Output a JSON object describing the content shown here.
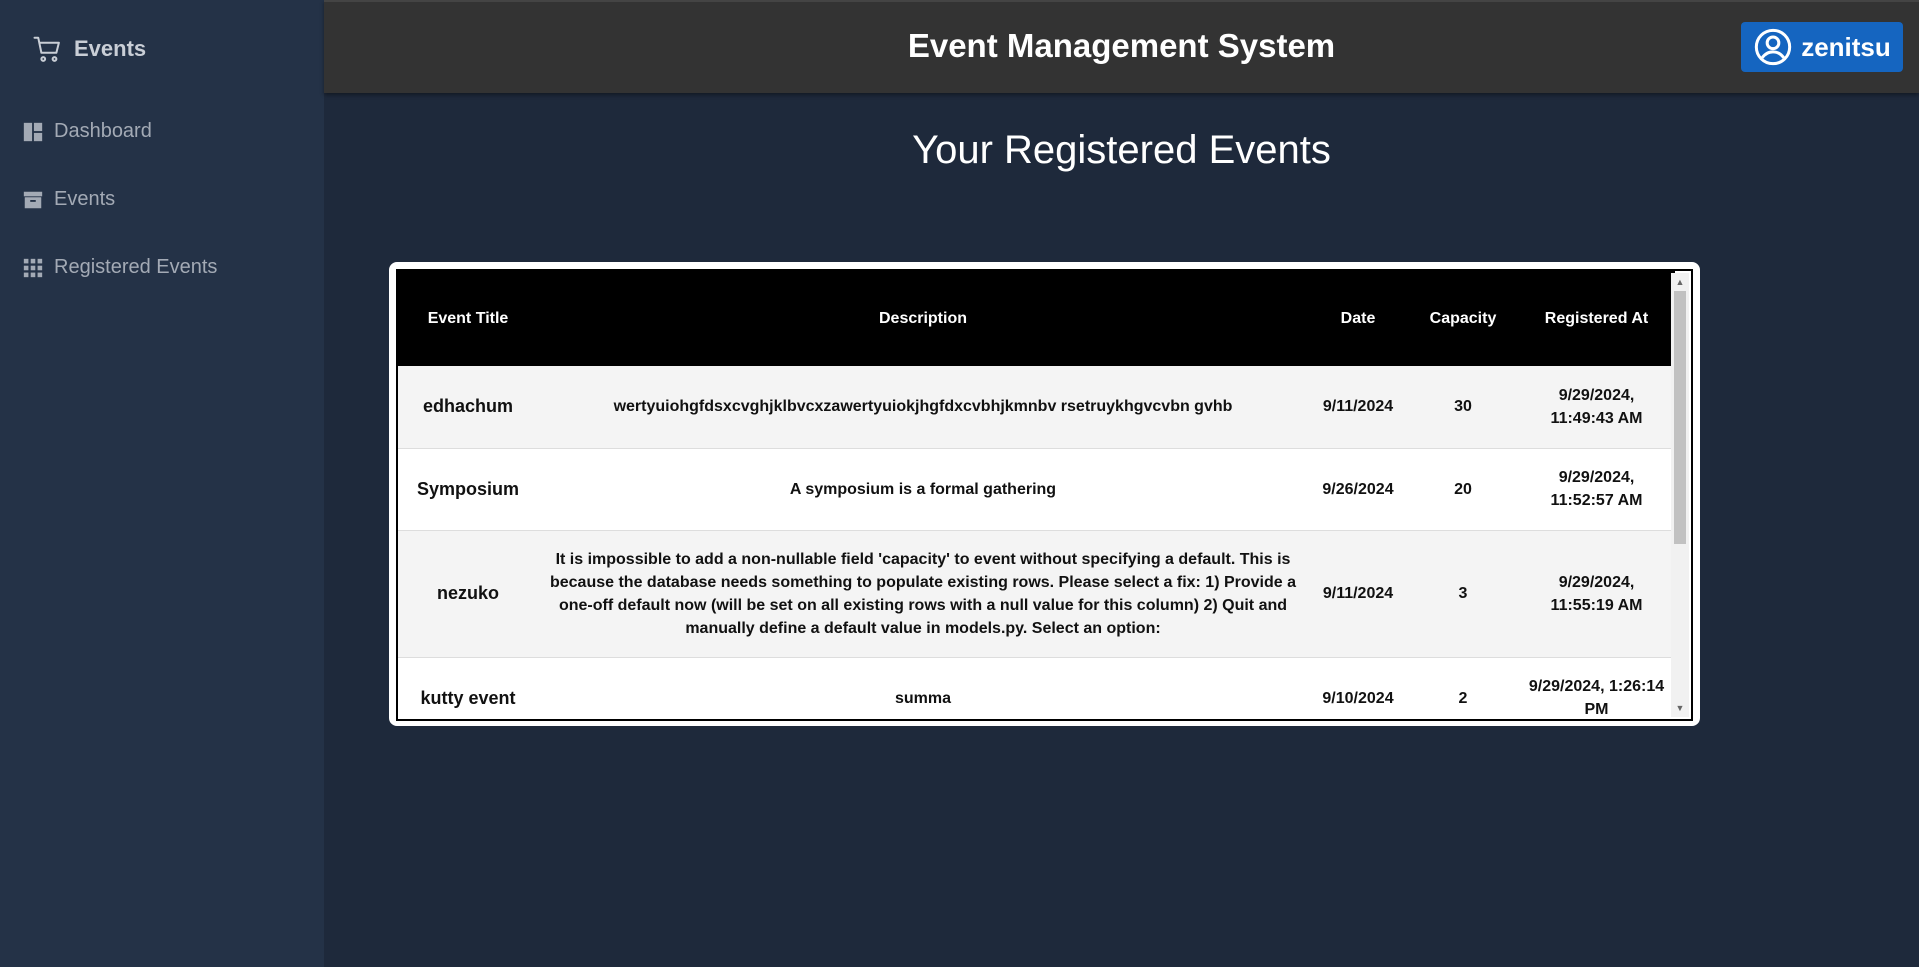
{
  "sidebar": {
    "brand_label": "Events",
    "items": [
      {
        "label": "Dashboard",
        "icon": "dashboard-icon"
      },
      {
        "label": "Events",
        "icon": "archive-icon"
      },
      {
        "label": "Registered Events",
        "icon": "grid-icon"
      }
    ]
  },
  "header": {
    "title": "Event Management System",
    "user_name": "zenitsu"
  },
  "main": {
    "heading": "Your Registered Events",
    "table": {
      "columns": [
        "Event Title",
        "Description",
        "Date",
        "Capacity",
        "Registered At"
      ],
      "rows": [
        {
          "title": "edhachum",
          "description": "wertyuiohgfdsxcvghjklbvcxzawertyuiokjhgfdxcvbhjkmnbv rsetruykhgvcvbn gvhb",
          "date": "9/11/2024",
          "capacity": "30",
          "registered_at": "9/29/2024, 11:49:43 AM"
        },
        {
          "title": "Symposium",
          "description": "A symposium is a formal gathering",
          "date": "9/26/2024",
          "capacity": "20",
          "registered_at": "9/29/2024, 11:52:57 AM"
        },
        {
          "title": "nezuko",
          "description": "It is impossible to add a non-nullable field 'capacity' to event without specifying a default. This is because the database needs something to populate existing rows. Please select a fix: 1) Provide a one-off default now (will be set on all existing rows with a null value for this column) 2) Quit and manually define a default value in models.py. Select an option:",
          "date": "9/11/2024",
          "capacity": "3",
          "registered_at": "9/29/2024, 11:55:19 AM"
        },
        {
          "title": "kutty event",
          "description": "summa",
          "date": "9/10/2024",
          "capacity": "2",
          "registered_at": "9/29/2024, 1:26:14 PM"
        }
      ]
    },
    "scroll_position": 0.0,
    "scroll_visible_fraction": 0.62
  },
  "colors": {
    "background": "#1e293b",
    "sidebar": "#243247",
    "topbar": "#333333",
    "user_button": "#1565c0",
    "table_header": "#000000"
  }
}
